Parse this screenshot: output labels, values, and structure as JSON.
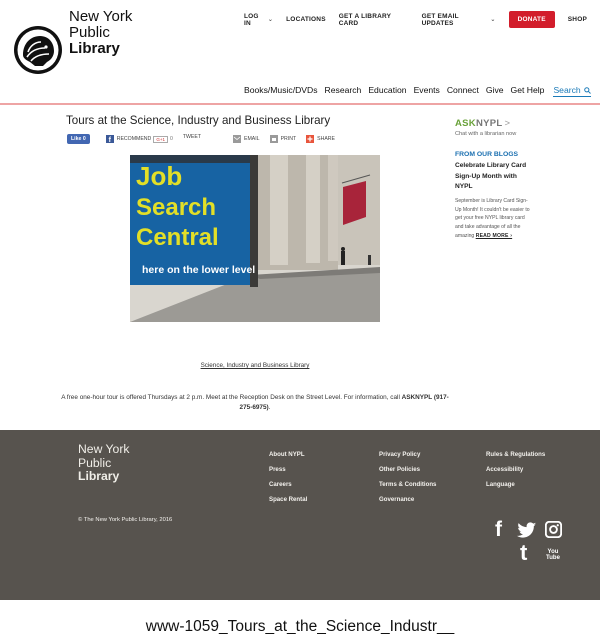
{
  "logo": {
    "line1": "New York",
    "line2": "Public",
    "line3": "Library"
  },
  "utility_nav": [
    {
      "label": "LOG IN",
      "caret": true
    },
    {
      "label": "LOCATIONS",
      "caret": false
    },
    {
      "label": "GET A LIBRARY CARD",
      "caret": false
    },
    {
      "label": "GET EMAIL UPDATES",
      "caret": true
    }
  ],
  "donate_label": "DONATE",
  "shop_label": "SHOP",
  "main_nav": [
    "Books/Music/DVDs",
    "Research",
    "Education",
    "Events",
    "Connect",
    "Give",
    "Get Help"
  ],
  "search_label": "Search",
  "article": {
    "title": "Tours at the Science, Industry and Business Library",
    "share": {
      "like": "Like 0",
      "recommend": "RECOMMEND",
      "gplus": "G+1",
      "gplus_count": "0",
      "tweet": "TWEET",
      "email": "EMAIL",
      "print": "PRINT",
      "share": "SHARE"
    },
    "photo": {
      "line1": "Job",
      "line2": "Search",
      "line3": "Central",
      "line4": "here on the lower level"
    },
    "caption": "Science, Industry and Business Library",
    "desc_text": "A free one-hour tour is offered Thursdays at 2 p.m. Meet at the Reception Desk on the Street Level. For information, call",
    "desc_bold": "ASKNYPL (917-275-6975)",
    "desc_end": "."
  },
  "sidebar": {
    "ask_a": "ASK",
    "ask_b": "NYPL",
    "ask_gt": ">",
    "ask_sub": "Chat with a librarian now",
    "blog_heading": "FROM OUR BLOGS",
    "blog_title": "Celebrate Library Card Sign-Up Month with NYPL",
    "blog_body": "September is Library Card Sign-Up Month! It couldn't be easier to get your free NYPL library card and take advantage of all the amazing",
    "read_more": "READ MORE ›"
  },
  "footer": {
    "logo_line1": "New York",
    "logo_line2": "Public",
    "logo_line3": "Library",
    "col1": [
      "About NYPL",
      "Press",
      "Careers",
      "Space Rental"
    ],
    "col2": [
      "Privacy Policy",
      "Other Policies",
      "Terms & Conditions",
      "Governance"
    ],
    "col3": [
      "Rules & Regulations",
      "Accessibility",
      "Language"
    ],
    "copyright": "© The New York Public Library, 2016",
    "social": {
      "facebook": "f",
      "tumblr": "t",
      "youtube": "You Tube"
    }
  },
  "bottom_label": "www-1059_Tours_at_the_Science_Industr__",
  "colors": {
    "donate": "#d21d2b",
    "footer": "#57534e",
    "link_blue": "#1a6fb0",
    "ask_green": "#6aa23a"
  }
}
